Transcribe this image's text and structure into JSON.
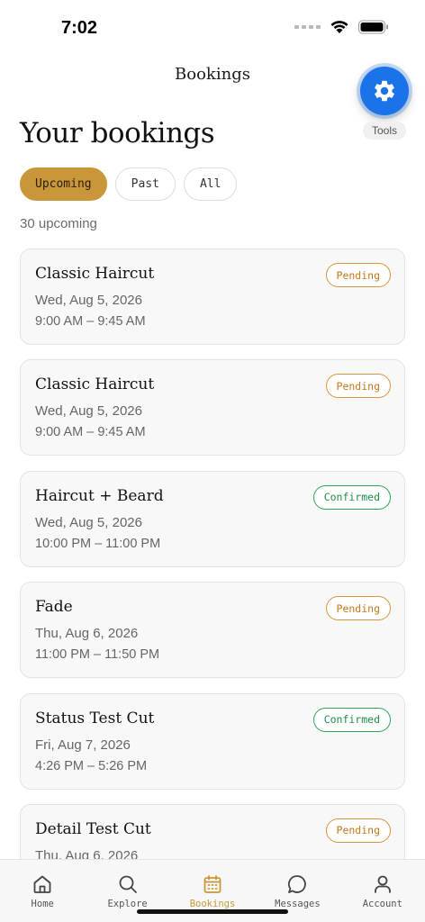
{
  "status": {
    "time": "7:02"
  },
  "header": {
    "title": "Bookings"
  },
  "tools": {
    "label": "Tools"
  },
  "page": {
    "title": "Your bookings",
    "count_text": "30 upcoming"
  },
  "filters": [
    {
      "label": "Upcoming",
      "active": true
    },
    {
      "label": "Past",
      "active": false
    },
    {
      "label": "All",
      "active": false
    }
  ],
  "bookings": [
    {
      "service": "Classic Haircut",
      "date": "Wed, Aug 5, 2026",
      "time": "9:00 AM – 9:45 AM",
      "status": "Pending"
    },
    {
      "service": "Classic Haircut",
      "date": "Wed, Aug 5, 2026",
      "time": "9:00 AM – 9:45 AM",
      "status": "Pending"
    },
    {
      "service": "Haircut + Beard",
      "date": "Wed, Aug 5, 2026",
      "time": "10:00 PM – 11:00 PM",
      "status": "Confirmed"
    },
    {
      "service": "Fade",
      "date": "Thu, Aug 6, 2026",
      "time": "11:00 PM – 11:50 PM",
      "status": "Pending"
    },
    {
      "service": "Status Test Cut",
      "date": "Fri, Aug 7, 2026",
      "time": "4:26 PM – 5:26 PM",
      "status": "Confirmed"
    },
    {
      "service": "Detail Test Cut",
      "date": "Thu, Aug 6, 2026",
      "time": "",
      "status": "Pending"
    }
  ],
  "tabs": [
    {
      "label": "Home",
      "icon": "home-icon",
      "active": false
    },
    {
      "label": "Explore",
      "icon": "search-icon",
      "active": false
    },
    {
      "label": "Bookings",
      "icon": "calendar-icon",
      "active": true
    },
    {
      "label": "Messages",
      "icon": "chat-bubble-icon",
      "active": false
    },
    {
      "label": "Account",
      "icon": "person-icon",
      "active": false
    }
  ],
  "colors": {
    "accent": "#c9973a",
    "pending": "#d4963a",
    "confirmed": "#2aa556",
    "fab": "#1a73e8"
  }
}
